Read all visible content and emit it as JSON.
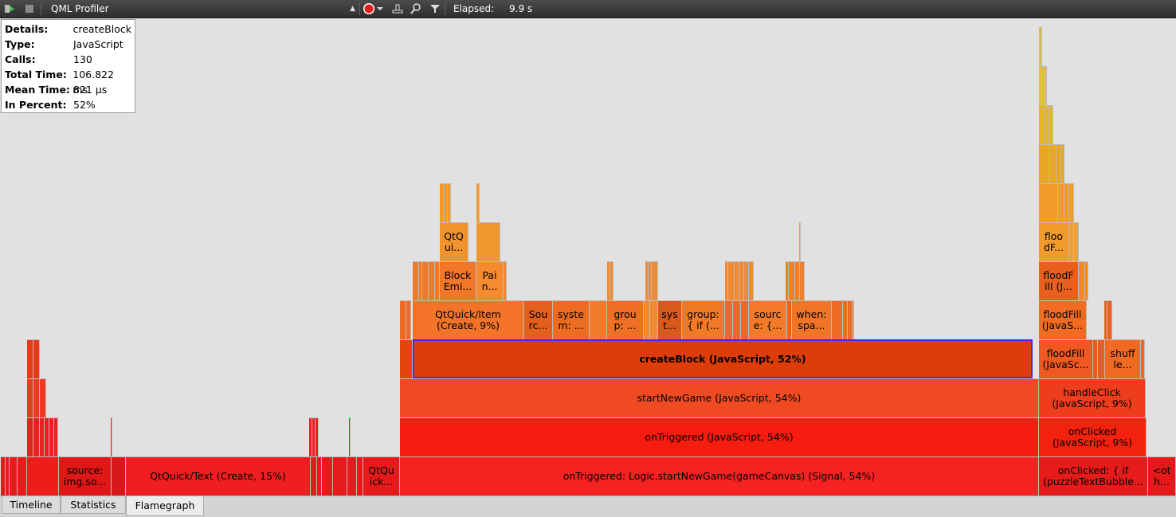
{
  "toolbar": {
    "run_icon": "run-arrow-icon",
    "stop_icon": "stop-icon",
    "view_combo": "QML Profiler",
    "elapsed_label": "Elapsed:",
    "elapsed_value": "9.9 s",
    "colors": {
      "record": "#e01b1b"
    }
  },
  "details": {
    "rows": [
      {
        "key": "Details:",
        "value": "createBlock"
      },
      {
        "key": "Type:",
        "value": "JavaScript"
      },
      {
        "key": "Calls:",
        "value": "130"
      },
      {
        "key": "Total Time:",
        "value": "106.822 ms"
      },
      {
        "key": "Mean Time:",
        "value": "821 µs"
      },
      {
        "key": "In Percent:",
        "value": "52%"
      }
    ]
  },
  "flamegraph": {
    "labels": {
      "root_main": "onTriggered: Logic.startNewGame(gameCanvas) (Signal, 54%)",
      "root_text": "QtQuick/Text (Create, 15%)",
      "root_source": "source:\nimg.so...",
      "root_qtquick": "QtQu\nick...",
      "root_onclicked": "onClicked: { if\n(puzzleTextBubble...",
      "root_other": "<ot\nh...",
      "l1_ontriggered": "onTriggered (JavaScript, 54%)",
      "l1_onclicked": "onClicked\n(JavaScript, 9%)",
      "l2_startnewgame": "startNewGame (JavaScript, 54%)",
      "l2_handleclick": "handleClick\n(JavaScript, 9%)",
      "l3_createblock": "createBlock (JavaScript, 52%)",
      "l3_floodfill": "floodFill\n(JavaSc...",
      "l3_shuffle": "shuff\nle...",
      "l4_item": "QtQuick/Item\n(Create, 9%)",
      "l4_source": "Sou\nrc...",
      "l4_system": "syste\nm: ...",
      "l4_group1": "grou\np: ...",
      "l4_sys": "sys\nt...",
      "l4_group2": "group:\n{ if (...",
      "l4_source2": "sourc\ne: {...",
      "l4_when": "when:\nspa...",
      "l4_floodfill": "floodFill\n(JavaS...",
      "l5_block": "Block\nEmi...",
      "l5_pain": "Pai\nn...",
      "l5_floodfill": "floodF\nill (J...",
      "l6_qtq": "QtQ\nui...",
      "l6_flood": "floo\ndF..."
    }
  },
  "tabs": [
    "Timeline",
    "Statistics",
    "Flamegraph"
  ]
}
